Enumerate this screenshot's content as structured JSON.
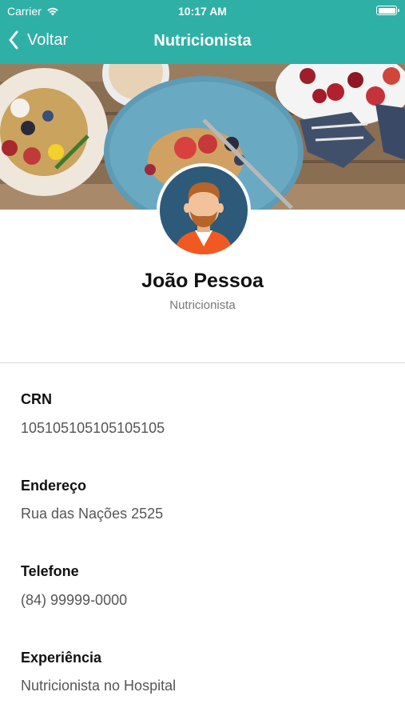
{
  "status_bar": {
    "carrier": "Carrier",
    "time": "10:17 AM"
  },
  "nav": {
    "back_label": "Voltar",
    "title": "Nutricionista"
  },
  "profile": {
    "name": "João Pessoa",
    "role": "Nutricionista"
  },
  "fields": [
    {
      "label": "CRN",
      "value": "105105105105105105"
    },
    {
      "label": "Endereço",
      "value": "Rua das Nações 2525"
    },
    {
      "label": "Telefone",
      "value": "(84) 99999-0000"
    },
    {
      "label": "Experiência",
      "value": "Nutricionista no Hospital"
    }
  ],
  "colors": {
    "header": "#2fb0a6",
    "avatar_bg": "#2d5a78",
    "shirt": "#f05a22",
    "skin": "#f2c39a",
    "hair": "#b5652a"
  },
  "icons": {
    "wifi": "wifi-icon",
    "battery": "battery-icon",
    "back": "chevron-left-icon"
  }
}
